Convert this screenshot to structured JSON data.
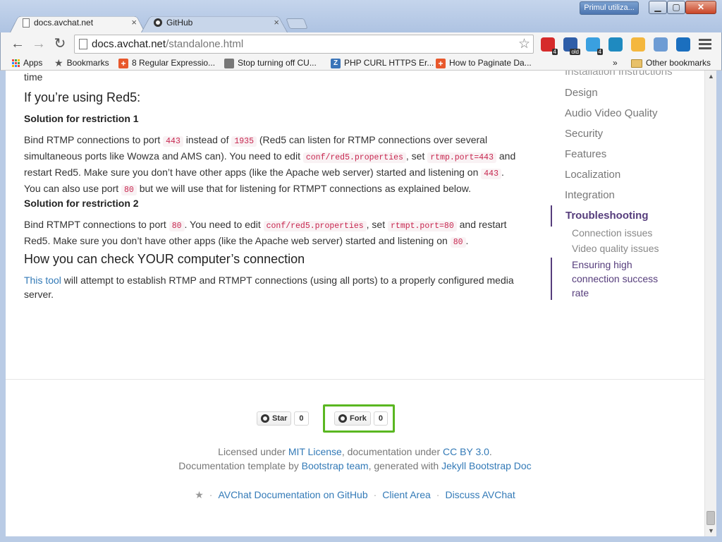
{
  "window": {
    "profile_name": "Primul utiliza...",
    "min_label": "▁",
    "max_label": "▢",
    "close_label": "✕"
  },
  "tabs": [
    {
      "title": "docs.avchat.net",
      "close": "×"
    },
    {
      "title": "GitHub",
      "close": "×"
    }
  ],
  "toolbar": {
    "back": "←",
    "forward": "→",
    "reload": "↻",
    "url_host": "docs.avchat.net",
    "url_path": "/standalone.html",
    "star": "☆",
    "extensions": [
      {
        "name": "opera-extension",
        "color": "#d62b2b",
        "badge": "4"
      },
      {
        "name": "old-extension",
        "color": "#2f5ea8",
        "badge": "old"
      },
      {
        "name": "ghost-extension",
        "color": "#3aa0e0",
        "badge": "4"
      },
      {
        "name": "molecule-extension",
        "color": "#1f8ac0",
        "badge": ""
      },
      {
        "name": "k-extension",
        "color": "#f4b73e",
        "badge": ""
      },
      {
        "name": "camera-extension",
        "color": "#6d9cd4",
        "badge": ""
      },
      {
        "name": "screen-capture-extension",
        "color": "#1b6fbf",
        "badge": ""
      }
    ]
  },
  "bookmarks": {
    "items": [
      {
        "label": "Apps",
        "icon": "apps-grid-icon"
      },
      {
        "label": "Bookmarks",
        "icon": "star-icon"
      },
      {
        "label": "8 Regular Expressio...",
        "icon": "plus-icon",
        "color": "#e8582c"
      },
      {
        "label": "Stop turning off CU...",
        "icon": "page-icon",
        "color": "#666"
      },
      {
        "label": "PHP CURL HTTPS Er...",
        "icon": "z-icon",
        "color": "#3a74b8"
      },
      {
        "label": "How to Paginate Da...",
        "icon": "plus-icon",
        "color": "#e8582c"
      }
    ],
    "overflow": "»",
    "other": "Other bookmarks"
  },
  "content": {
    "fragment_top": "time",
    "red5_heading": "If you’re using Red5:",
    "sol1_heading": "Solution for restriction 1",
    "sol1": {
      "t1": "Bind RTMP connections to port ",
      "c1": "443",
      "t2": " instead of ",
      "c2": "1935",
      "t3": " (Red5 can listen for RTMP connections over several simultaneous ports like Wowza and AMS can). You need to edit ",
      "c3": "conf/red5.properties",
      "t4": ", set ",
      "c4": "rtmp.port=443",
      "t5": " and restart Red5. Make sure you don’t have other apps (like the Apache web server) started and listening on ",
      "c5": "443",
      "t6": ". You can also use port ",
      "c6": "80",
      "t7": " but we will use that for listening for RTMPT connections as explained below."
    },
    "sol2_heading": "Solution for restriction 2",
    "sol2": {
      "t1": "Bind RTMPT connections to port ",
      "c1": "80",
      "t2": ". You need to edit ",
      "c2": "conf/red5.properties",
      "t3": ", set ",
      "c3": "rtmpt.port=80",
      "t4": " and restart Red5. Make sure you don’t have other apps (like the Apache web server) started and listening on ",
      "c4": "80",
      "t5": "."
    },
    "check_heading": "How you can check YOUR computer’s connection",
    "check": {
      "link": "This tool",
      "text": " will attempt to establish RTMP and RTMPT connections (using all ports) to a properly configured media server."
    }
  },
  "sidenav": {
    "cut_item": "Installation Instructions",
    "items": [
      "Design",
      "Audio Video Quality",
      "Security",
      "Features",
      "Localization",
      "Integration"
    ],
    "active": "Troubleshooting",
    "children": [
      "Connection issues",
      "Video quality issues"
    ],
    "active_child": "Ensuring high connection success rate"
  },
  "footer": {
    "star_label": "Star",
    "star_count": "0",
    "fork_label": "Fork",
    "fork_count": "0",
    "license_t1": "Licensed under ",
    "license_link1": "MIT License",
    "license_t2": ", documentation under ",
    "license_link2": "CC BY 3.0",
    "license_t3": ".",
    "template_t1": "Documentation template by ",
    "template_link1": "Bootstrap team",
    "template_t2": ", generated with ",
    "template_link2": "Jekyll Bootstrap Doc",
    "star_glyph": "★",
    "links": [
      "AVChat Documentation on GitHub",
      "Client Area",
      "Discuss AVChat"
    ],
    "separator": "·"
  },
  "colors": {
    "link": "#337ab7",
    "nav_active": "#563d7c",
    "code": "#c7254e",
    "highlight_box": "#5ab721"
  }
}
